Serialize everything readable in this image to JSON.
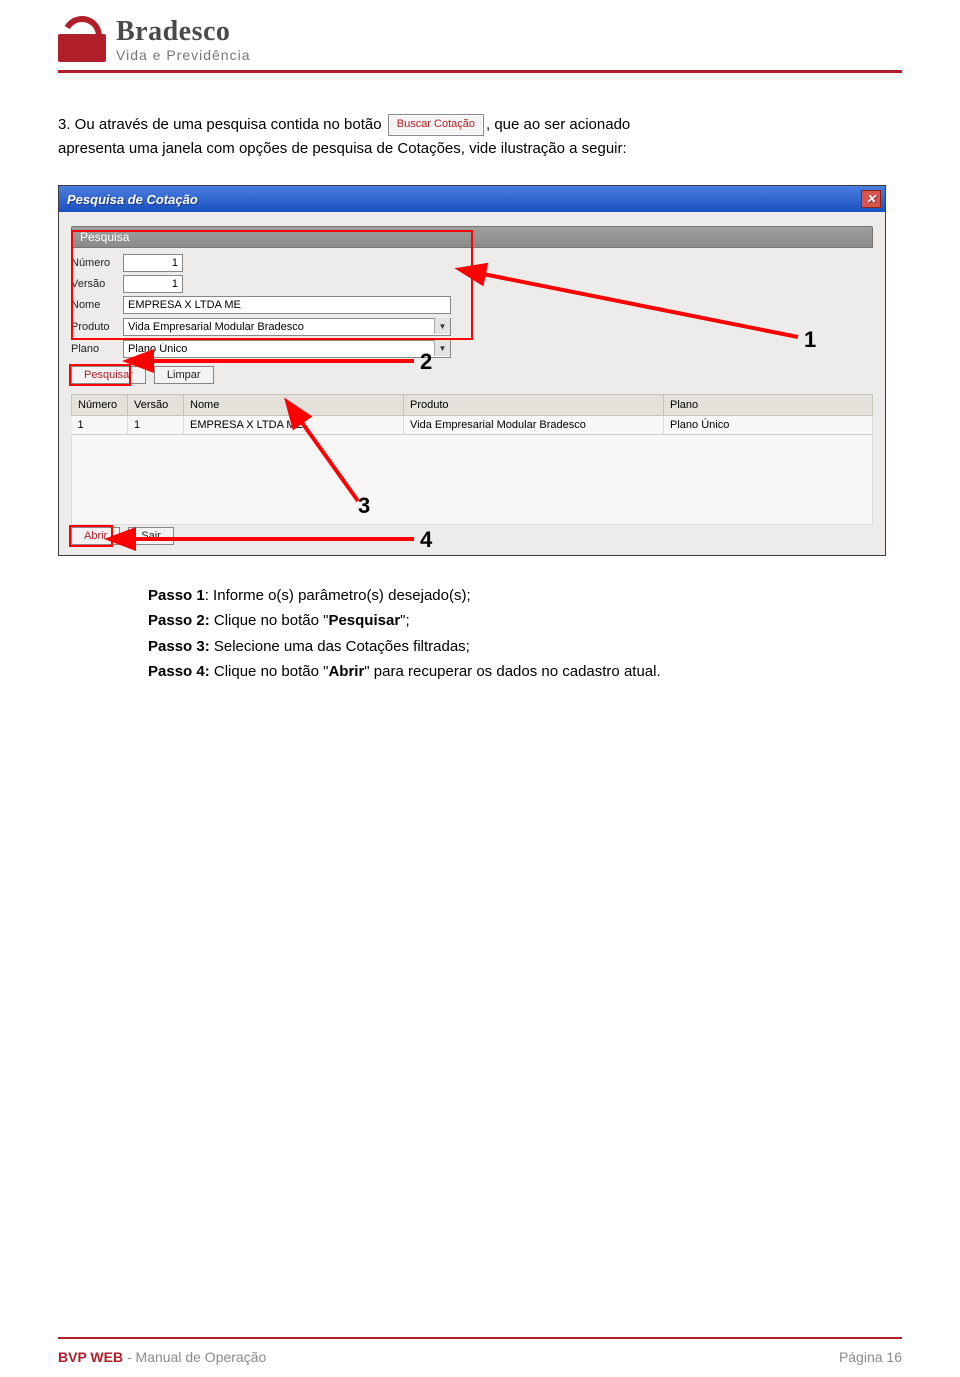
{
  "logo": {
    "brand": "Bradesco",
    "sub": "Vida e Previdência"
  },
  "intro": {
    "num": "3.",
    "line1a": " Ou através de uma pesquisa contida no botão ",
    "btn_buscar": "Buscar Cotação",
    "line1b": ", que ao ser acionado",
    "line2": "apresenta uma janela com opções de pesquisa de Cotações, vide ilustração a seguir:"
  },
  "dialog": {
    "title": "Pesquisa de Cotação",
    "section": "Pesquisa",
    "labels": {
      "numero": "Número",
      "versao": "Versão",
      "nome": "Nome",
      "produto": "Produto",
      "plano": "Plano"
    },
    "values": {
      "numero": "1",
      "versao": "1",
      "nome": "EMPRESA X LTDA ME",
      "produto": "Vida Empresarial Modular Bradesco",
      "plano": "Plano Único"
    },
    "buttons": {
      "pesquisar": "Pesquisar",
      "limpar": "Limpar",
      "abrir": "Abrir",
      "sair": "Sair"
    },
    "table": {
      "headers": [
        "Número",
        "Versão",
        "Nome",
        "Produto",
        "Plano"
      ],
      "row": [
        "1",
        "1",
        "EMPRESA X LTDA ME",
        "Vida Empresarial Modular Bradesco",
        "Plano Único"
      ]
    }
  },
  "callouts": {
    "c1": "1",
    "c2": "2",
    "c3": "3",
    "c4": "4"
  },
  "steps": {
    "p1a": "Passo 1",
    "p1b": ": Informe o(s) parâmetro(s) desejado(s);",
    "p2a": "Passo 2:",
    "p2b": " Clique no botão \"",
    "p2c": "Pesquisar",
    "p2d": "\";",
    "p3a": "Passo 3:",
    "p3b": " Selecione uma das Cotações filtradas;",
    "p4a": "Passo 4:",
    "p4b": " Clique no botão \"",
    "p4c": "Abrir",
    "p4d": "\" para recuperar os dados no cadastro atual."
  },
  "footer": {
    "bvp": "BVP WEB",
    "rest": " - Manual de Operação",
    "page": "Página 16"
  }
}
